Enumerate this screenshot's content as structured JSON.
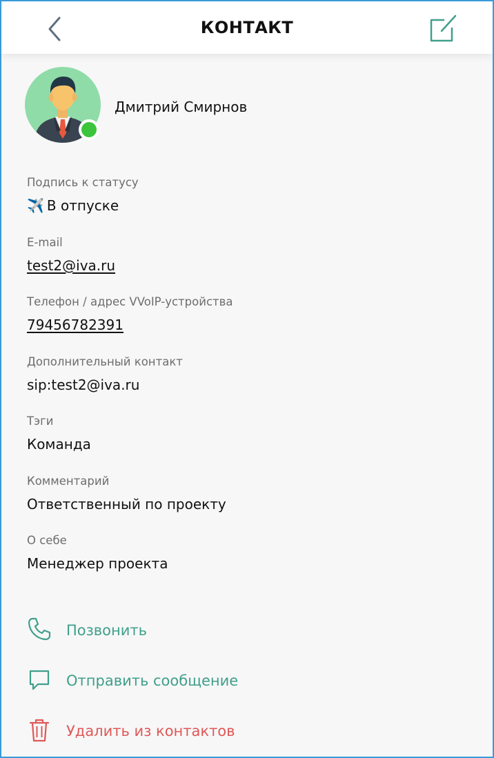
{
  "header": {
    "title": "КОНТАКТ",
    "back_icon": "chevron-left-icon",
    "edit_icon": "edit-icon"
  },
  "profile": {
    "name": "Дмитрий Смирнов",
    "status": "online",
    "avatar_icon": "avatar-businessman"
  },
  "fields": {
    "status_caption": {
      "label": "Подпись к статусу",
      "emoji": "✈️",
      "value": "В отпуске"
    },
    "email": {
      "label": "E-mail",
      "value": "test2@iva.ru"
    },
    "phone": {
      "label": "Телефон / адрес VVoIP-устройства",
      "value": "79456782391"
    },
    "extra_contact": {
      "label": "Дополнительный контакт",
      "value": "sip:test2@iva.ru"
    },
    "tags": {
      "label": "Тэги",
      "value": "Команда"
    },
    "comment": {
      "label": "Комментарий",
      "value": "Ответственный по проекту"
    },
    "about": {
      "label": "О себе",
      "value": "Менеджер проекта"
    }
  },
  "actions": {
    "call": {
      "label": "Позвонить",
      "icon": "phone-icon"
    },
    "message": {
      "label": "Отправить сообщение",
      "icon": "chat-bubble-icon"
    },
    "delete": {
      "label": "Удалить из контактов",
      "icon": "trash-icon"
    }
  },
  "colors": {
    "accent_green": "#3f9f8b",
    "danger_red": "#e05757",
    "online": "#3cc43c",
    "frame_border": "#3a9ad9"
  }
}
